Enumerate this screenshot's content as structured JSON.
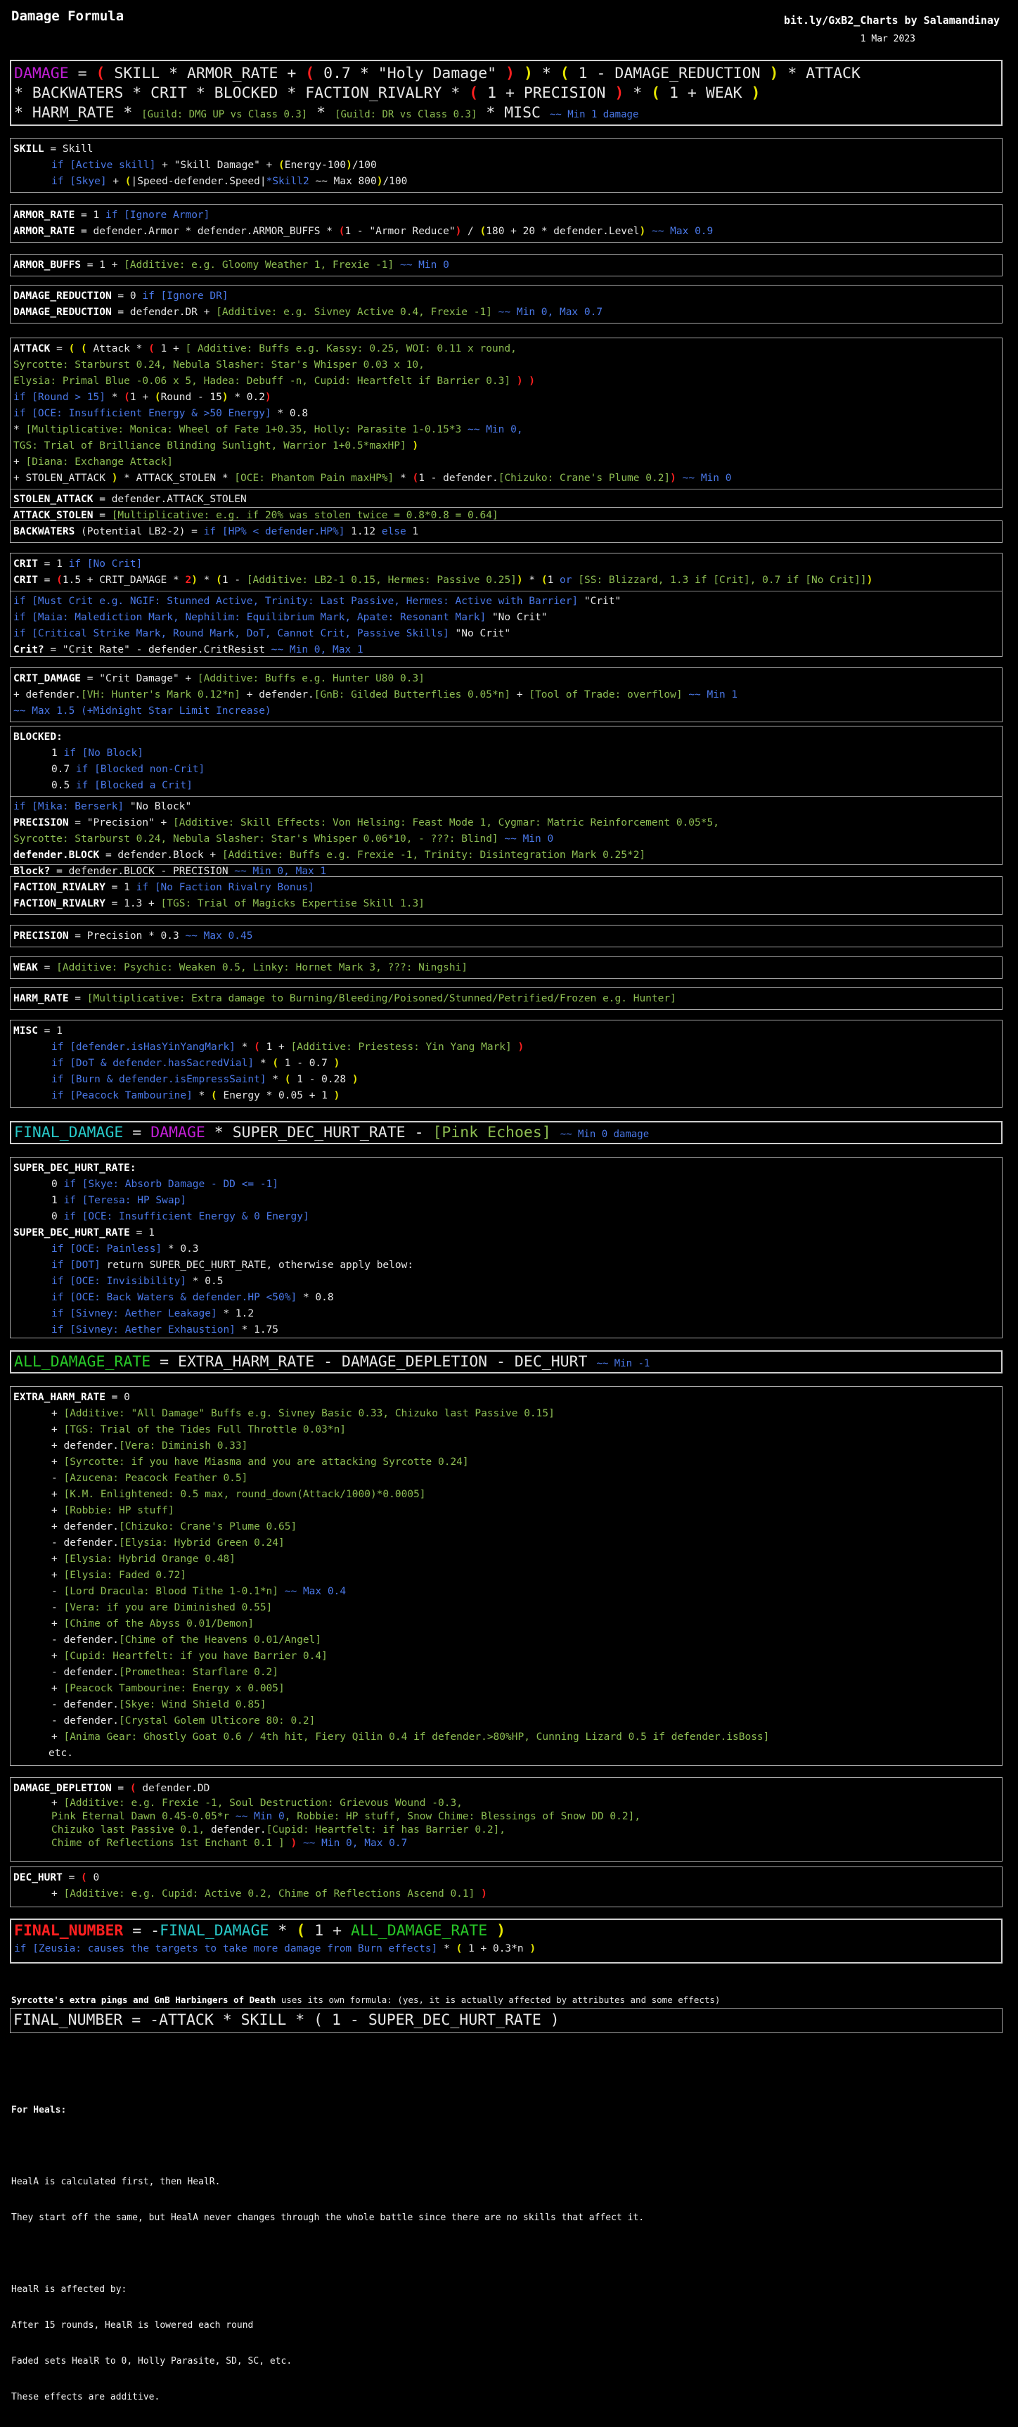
{
  "header": {
    "title": "Damage Formula",
    "credit": "bit.ly/GxB2_Charts by Salamandinay",
    "date": "1 Mar 2023"
  },
  "formula": {
    "l1": [
      "DAMAGE",
      " = ",
      "(",
      " SKILL * ARMOR_RATE + ",
      "(",
      " 0.7 * \"Holy Damage\" ",
      ")",
      " ",
      ")",
      " * ",
      "(",
      " 1 - DAMAGE_REDUCTION ",
      ")",
      " * ATTACK"
    ],
    "l2": [
      "* BACKWATERS * CRIT * BLOCKED * FACTION_RIVALRY * ",
      "(",
      " 1 + PRECISION ",
      ")",
      " * ",
      "(",
      " 1 + WEAK ",
      ")"
    ],
    "l3": [
      "* HARM_RATE * ",
      "[Guild: DMG UP vs Class 0.3]",
      " * ",
      "[Guild: DR vs Class 0.3]",
      " * MISC ",
      "~~ Min 1 damage"
    ]
  },
  "skill": {
    "l1": [
      "SKILL",
      " = Skill"
    ],
    "l2": [
      "if ",
      "[Active skill]",
      " + \"Skill Damage\" + ",
      "(",
      "Energy-100",
      ")",
      "/100"
    ],
    "l3": [
      "if ",
      "[Skye]",
      " + ",
      "(",
      "|Speed-defender.Speed|",
      "*Skill2 ",
      "~~ Max 800",
      ")",
      "/100"
    ]
  },
  "armor": {
    "l1": [
      "ARMOR_RATE",
      " = 1 ",
      "if ",
      "[Ignore Armor]"
    ],
    "l2": [
      "ARMOR_RATE",
      " = defender.Armor * defender.ARMOR_BUFFS * ",
      "(",
      "1 - \"Armor Reduce\"",
      ")",
      " / ",
      "(",
      "180 + 20 * defender.Level",
      ")",
      " ",
      "~~ Max 0.9"
    ]
  },
  "armor_buffs": {
    "l1": [
      "ARMOR_BUFFS",
      " = 1 + ",
      "[Additive: e.g. Gloomy Weather 1, Frexie -1]",
      " ",
      "~~ Min 0"
    ]
  },
  "dmg_red": {
    "l1": [
      "DAMAGE_REDUCTION",
      " = 0 ",
      "if ",
      "[Ignore DR]"
    ],
    "l2": [
      "DAMAGE_REDUCTION",
      " = defender.DR + ",
      "[Additive: e.g. Sivney Active 0.4, Frexie -1]",
      " ",
      "~~ Min 0, Max 0.7"
    ]
  },
  "attack": {
    "l1": [
      "ATTACK",
      " = ",
      "( ( ",
      "Attack * ",
      "(",
      " 1 + ",
      "[ Additive: Buffs e.g. Kassy: 0.25, WOI: 0.11 x round,"
    ],
    "l2": [
      "Syrcotte: Starburst 0.24, Nebula Slasher: Star's Whisper 0.03 x 10,"
    ],
    "l3": [
      "Elysia: Primal Blue -0.06 x 5, Hadea: Debuff -n, Cupid: Heartfelt if Barrier 0.3]",
      " ) )"
    ],
    "l4": [
      "if ",
      "[Round > 15]",
      " * ",
      "(",
      "1 + ",
      "(",
      "Round - 15",
      ")",
      " * 0.2",
      ")"
    ],
    "l5": [
      "if ",
      "[OCE: Insufficient Energy & >50 Energy]",
      " * 0.8"
    ],
    "l6": [
      "* ",
      "[Multiplicative: Monica: Wheel of Fate 1+0.35, Holly: Parasite 1-0.15*3 ",
      "~~ Min 0,"
    ],
    "l7": [
      "TGS: Trial of Brilliance Blinding Sunlight, Warrior 1+0.5*maxHP]",
      " )"
    ],
    "l8": [
      "+ ",
      "[Diana: Exchange Attack]"
    ],
    "l9": [
      "+ STOLEN_ATTACK ",
      ")",
      " * ATTACK_STOLEN * ",
      "[OCE: Phantom Pain maxHP%]",
      " * ",
      "(",
      "1 - defender.",
      "[Chizuko: Crane's Plume 0.2]",
      ")",
      " ",
      "~~ Min 0"
    ],
    "l10": [
      "STOLEN_ATTACK",
      " = defender.ATTACK_STOLEN"
    ],
    "l11": [
      "ATTACK_STOLEN",
      " = ",
      "[Multiplicative: e.g. if 20% was stolen twice = 0.8*0.8 = 0.64]"
    ]
  },
  "backwaters": {
    "l1": [
      "BACKWATERS",
      " (Potential LB2-2) = ",
      "if ",
      "[HP% < defender.HP%]",
      " 1.12 ",
      "else",
      " 1"
    ]
  },
  "crit": {
    "l1": [
      "CRIT",
      " = 1 ",
      "if ",
      "[No Crit]"
    ],
    "l2": [
      "CRIT",
      " = ",
      "(",
      "1.5 + CRIT_DAMAGE * ",
      "2",
      ")",
      " * ",
      "(",
      "1 - ",
      "[Additive: LB2-1 0.15, Hermes: Passive 0.25]",
      ")",
      " * ",
      "(",
      "1 ",
      "or",
      " ",
      "[SS: Blizzard, 1.3 if [Crit], 0.7 if [No Crit]]",
      ")"
    ],
    "l3": [
      "if ",
      "[Must Crit e.g. NGIF: Stunned Active, Trinity: Last Passive, Hermes: Active with Barrier]",
      " \"Crit\""
    ],
    "l4": [
      "if ",
      "[Maia: Malediction Mark, Nephilim: Equilibrium Mark, Apate: Resonant Mark]",
      " \"No Crit\""
    ],
    "l5": [
      "if ",
      "[Critical Strike Mark, Round Mark, DoT, Cannot Crit, Passive Skills]",
      " \"No Crit\""
    ],
    "l6": [
      "Crit?",
      " = \"Crit Rate\" - defender.CritResist ",
      "~~ Min 0, Max 1"
    ]
  },
  "crit_damage": {
    "l1": [
      "CRIT_DAMAGE",
      " = \"Crit Damage\" + ",
      "[Additive: Buffs e.g. Hunter U80 0.3]"
    ],
    "l2": [
      "+ defender.",
      "[VH: Hunter's Mark 0.12*n]",
      " + defender.",
      "[GnB: Gilded Butterflies 0.05*n]",
      " + ",
      "[Tool of Trade: overflow]",
      " ",
      "~~ Min 1"
    ],
    "l3": [
      "~~ Max 1.5 (+Midnight Star Limit Increase)"
    ]
  },
  "blocked": {
    "l1": [
      "BLOCKED:"
    ],
    "l2": [
      "1 ",
      "if ",
      "[No Block]"
    ],
    "l3": [
      "0.7 ",
      "if ",
      "[Blocked non-Crit]"
    ],
    "l4": [
      "0.5 ",
      "if ",
      "[Blocked a Crit]"
    ],
    "l5": [
      "if ",
      "[Mika: Berserk]",
      " \"No Block\""
    ],
    "l6": [
      "PRECISION",
      " = \"Precision\" + ",
      "[Additive: Skill Effects: Von Helsing: Feast Mode 1, Cygmar: Matric Reinforcement 0.05*5,"
    ],
    "l7": [
      "Syrcotte: Starburst 0.24, Nebula Slasher: Star's Whisper 0.06*10, - ???: Blind]",
      " ",
      "~~ Min 0"
    ],
    "l8": [
      "defender.BLOCK",
      " = defender.Block + ",
      "[Additive: Buffs e.g. Frexie -1, Trinity: Disintegration Mark 0.25*2]"
    ],
    "l9": [
      "Block?",
      " = defender.BLOCK - PRECISION ",
      "~~ Min 0, Max 1"
    ]
  },
  "faction": {
    "l1": [
      "FACTION_RIVALRY",
      " = 1 ",
      "if ",
      "[No Faction Rivalry Bonus]"
    ],
    "l2": [
      "FACTION_RIVALRY",
      " = 1.3 + ",
      "[TGS: Trial of Magicks Expertise Skill 1.3]"
    ]
  },
  "precision": {
    "l1": [
      "PRECISION",
      " = Precision * 0.3 ",
      "~~ Max 0.45"
    ]
  },
  "weak": {
    "l1": [
      "WEAK",
      " = ",
      "[Additive: Psychic: Weaken 0.5, Linky: Hornet Mark 3, ???: Ningshi]"
    ]
  },
  "harm": {
    "l1": [
      "HARM_RATE",
      " = ",
      "[Multiplicative: Extra damage to Burning/Bleeding/Poisoned/Stunned/Petrified/Frozen e.g. Hunter]"
    ]
  },
  "misc": {
    "l1": [
      "MISC",
      " = 1"
    ],
    "l2": [
      "if ",
      "[defender.isHasYinYangMark]",
      " * ",
      "(",
      " 1 + ",
      "[Additive: Priestess: Yin Yang Mark]",
      " ",
      ")"
    ],
    "l3": [
      "if ",
      "[DoT & defender.hasSacredVial]",
      " * ",
      "(",
      " 1 - 0.7 ",
      ")"
    ],
    "l4": [
      "if ",
      "[Burn & defender.isEmpressSaint]",
      " * ",
      "(",
      " 1 - 0.28 ",
      ")"
    ],
    "l5": [
      "if ",
      "[Peacock Tambourine]",
      " * ",
      "(",
      " Energy * 0.05 + 1 ",
      ")"
    ]
  },
  "final_damage": {
    "l1": [
      "FINAL_DAMAGE",
      " = ",
      "DAMAGE",
      " * SUPER_DEC_HURT_RATE - ",
      "[",
      "Pink Echoes",
      "]",
      " ",
      "~~ Min 0 damage"
    ]
  },
  "super_dec": {
    "l1": [
      "SUPER_DEC_HURT_RATE:"
    ],
    "l2": [
      "0 ",
      "if ",
      "[Skye: Absorb Damage - DD <= -1]"
    ],
    "l3": [
      "1 ",
      "if ",
      "[Teresa: HP Swap]"
    ],
    "l4": [
      "0 ",
      "if ",
      "[OCE: Insufficient Energy & 0 Energy]"
    ],
    "l5": [
      "SUPER_DEC_HURT_RATE",
      " = 1"
    ],
    "l6": [
      "if ",
      "[OCE: Painless]",
      " * 0.3"
    ],
    "l7": [
      "if ",
      "[DOT]",
      " return SUPER_DEC_HURT_RATE, otherwise apply below:"
    ],
    "l8": [
      "if ",
      "[OCE: Invisibility]",
      " * 0.5"
    ],
    "l9": [
      "if ",
      "[OCE: Back Waters & defender.HP <50%]",
      " * 0.8"
    ],
    "l10": [
      "if ",
      "[Sivney: Aether Leakage]",
      " * 1.2"
    ],
    "l11": [
      "if ",
      "[Sivney: Aether Exhaustion]",
      " * 1.75"
    ]
  },
  "all_damage": {
    "l1": [
      "ALL_DAMAGE_RATE",
      " = EXTRA_HARM_RATE - DAMAGE_DEPLETION - DEC_HURT ",
      "~~ Min -1"
    ]
  },
  "extra_harm": {
    "l1": [
      "EXTRA_HARM_RATE",
      " = 0"
    ],
    "items": [
      [
        "+ ",
        "[Additive: \"All Damage\" Buffs e.g. Sivney Basic 0.33, Chizuko last Passive 0.15]"
      ],
      [
        "+ ",
        "[TGS: Trial of the Tides Full Throttle 0.03*n]"
      ],
      [
        "+ defender.",
        "[Vera: Diminish 0.33]"
      ],
      [
        "+ ",
        "[Syrcotte: if you have Miasma and you are attacking Syrcotte 0.24]"
      ],
      [
        "- ",
        "[Azucena: Peacock Feather 0.5]"
      ],
      [
        "+ ",
        "[K.M. Enlightened: 0.5 max, round_down(Attack/1000)*0.0005]"
      ],
      [
        "+ ",
        "[Robbie: HP stuff]"
      ],
      [
        "+ defender.",
        "[Chizuko: Crane's Plume 0.65]"
      ],
      [
        "- defender.",
        "[Elysia: Hybrid Green 0.24]"
      ],
      [
        "+ ",
        "[Elysia: Hybrid Orange 0.48]"
      ],
      [
        "+ ",
        "[Elysia: Faded 0.72]"
      ],
      [
        "- ",
        "[Lord Dracula: Blood Tithe 1-0.1*n]",
        " ",
        "~~ Max 0.4"
      ],
      [
        "- ",
        "[Vera: if you are Diminished 0.55]"
      ],
      [
        "+ ",
        "[Chime of the Abyss 0.01/Demon]"
      ],
      [
        "- defender.",
        "[Chime of the Heavens 0.01/Angel]"
      ],
      [
        "+ ",
        "[Cupid: Heartfelt: if you have Barrier 0.4]"
      ],
      [
        "- defender.",
        "[Promethea: Starflare 0.2]"
      ],
      [
        "+ ",
        "[Peacock Tambourine: Energy x 0.005]"
      ],
      [
        "- defender.",
        "[Skye: Wind Shield 0.85]"
      ],
      [
        "- defender.",
        "[Crystal Golem Ulticore 80: 0.2]"
      ],
      [
        "+ ",
        "[Anima Gear: Ghostly Goat 0.6 / 4th hit, Fiery Qilin 0.4 if defender.>80%HP, Cunning Lizard 0.5 if defender.isBoss]"
      ]
    ],
    "etc": "etc."
  },
  "depletion": {
    "l1": [
      "DAMAGE_DEPLETION",
      " = ",
      "(",
      " defender.DD"
    ],
    "l2": [
      "+ ",
      "[Additive: e.g. Frexie -1, Soul Destruction: Grievous Wound -0.3,"
    ],
    "l3": [
      "Pink Eternal Dawn 0.45-0.05*r ",
      "~~ Min 0",
      ", Robbie: HP stuff, Snow Chime: Blessings of Snow DD 0.2],"
    ],
    "l4": [
      "Chizuko last Passive 0.1, ",
      "defender.",
      "[Cupid: Heartfelt: if has Barrier 0.2],"
    ],
    "l5": [
      "Chime of Reflections 1st Enchant 0.1 ]",
      " ) ",
      "~~ Min 0, Max 0.7"
    ]
  },
  "dec_hurt": {
    "l1": [
      "DEC_HURT",
      " = ",
      "(",
      " 0"
    ],
    "l2": [
      "+ ",
      "[Additive: e.g. Cupid: Active 0.2, Chime of Reflections Ascend 0.1]",
      " )"
    ]
  },
  "final_number": {
    "l1": [
      "FINAL_NUMBER",
      " = -",
      "FINAL_DAMAGE",
      " * ",
      "(",
      " 1 + ",
      "ALL_DAMAGE_RATE",
      " ",
      ")"
    ],
    "l2": [
      "if ",
      "[Zeusia: causes the targets to take more damage from Burn effects]",
      " * ",
      "(",
      " 1 + 0.3*n ",
      ")"
    ]
  },
  "syrcotte": {
    "note": [
      "Syrcotte's extra pings and GnB Harbingers of Death",
      " uses its own formula: (yes, it is actually affected by attributes and some effects)"
    ],
    "formula": "FINAL_NUMBER = -ATTACK * SKILL * ( 1 - SUPER_DEC_HURT_RATE )"
  },
  "heals": {
    "lines": [
      "For Heals:",
      "",
      "HealA is calculated first, then HealR.",
      "They start off the same, but HealA never changes through the whole battle since there are no skills that affect it.",
      "",
      "HealR is affected by:",
      "After 15 rounds, HealR is lowered each round",
      "Faded sets HealR to 0, Holly Parasite, SD, SC, etc.",
      "These effects are additive."
    ]
  }
}
